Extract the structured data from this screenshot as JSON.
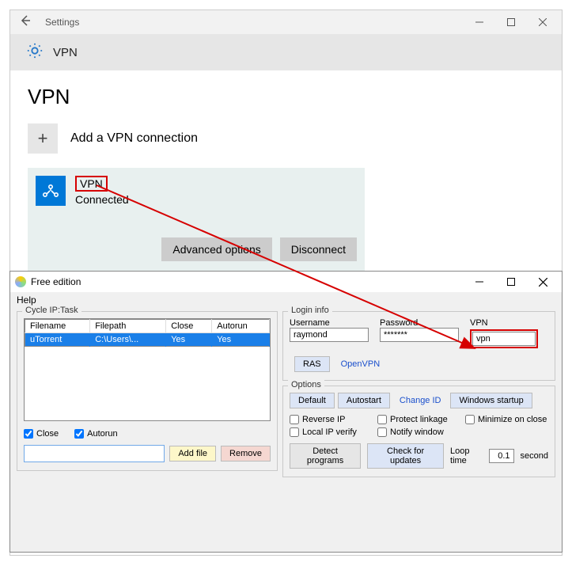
{
  "settings": {
    "titlebar": "Settings",
    "header": "VPN",
    "h1": "VPN",
    "add_label": "Add a VPN connection",
    "entry": {
      "name": "VPN",
      "status": "Connected"
    },
    "advanced_btn": "Advanced options",
    "disconnect_btn": "Disconnect"
  },
  "app": {
    "title": "Free edition",
    "menu_help": "Help",
    "groups": {
      "cycle": "Cycle IP:Task",
      "login": "Login info",
      "options": "Options"
    },
    "table": {
      "headers": [
        "Filename",
        "Filepath",
        "Close",
        "Autorun"
      ],
      "row": [
        "uTorrent",
        "C:\\Users\\...",
        "Yes",
        "Yes"
      ]
    },
    "checks": {
      "close": "Close",
      "autorun": "Autorun"
    },
    "btns": {
      "add_file": "Add file",
      "remove": "Remove"
    },
    "login": {
      "username_label": "Username",
      "username": "raymond",
      "password_label": "Password",
      "password": "*******",
      "vpn_label": "VPN",
      "vpn": "vpn",
      "ras": "RAS",
      "openvpn": "OpenVPN"
    },
    "options_btns": {
      "default": "Default",
      "autostart": "Autostart",
      "change_id": "Change ID",
      "win_startup": "Windows startup"
    },
    "option_chks": {
      "reverse_ip": "Reverse IP",
      "protect": "Protect linkage",
      "min_close": "Minimize on close",
      "local_ip": "Local IP verify",
      "notify": "Notify window"
    },
    "detect_programs": "Detect programs",
    "check_updates": "Check for updates",
    "loop_label": "Loop time",
    "loop_value": "0.1",
    "loop_unit": "second"
  }
}
